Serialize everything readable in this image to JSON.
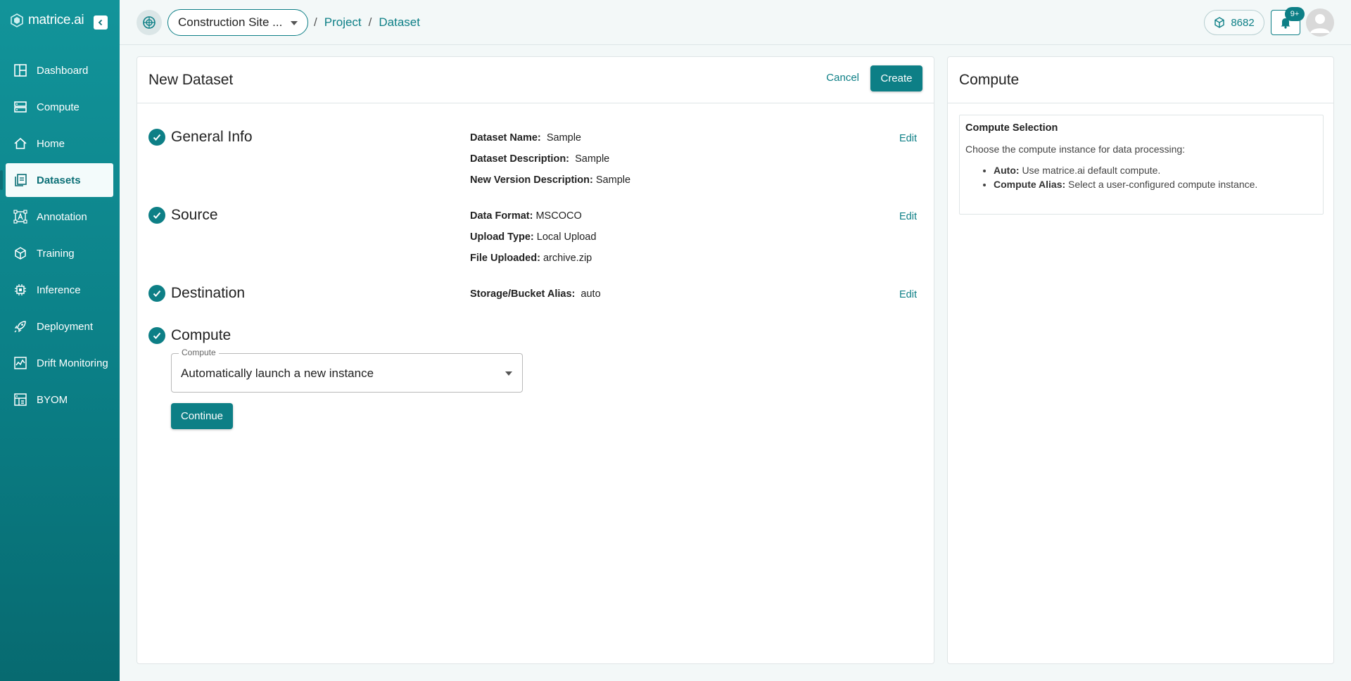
{
  "brand": {
    "name": "matrice.ai"
  },
  "sidebar": {
    "items": [
      {
        "label": "Dashboard",
        "icon": "dashboard-icon",
        "active": false
      },
      {
        "label": "Compute",
        "icon": "server-icon",
        "active": false
      },
      {
        "label": "Home",
        "icon": "home-icon",
        "active": false
      },
      {
        "label": "Datasets",
        "icon": "datasets-icon",
        "active": true
      },
      {
        "label": "Annotation",
        "icon": "annotation-icon",
        "active": false
      },
      {
        "label": "Training",
        "icon": "cube-icon",
        "active": false
      },
      {
        "label": "Inference",
        "icon": "chip-icon",
        "active": false
      },
      {
        "label": "Deployment",
        "icon": "rocket-icon",
        "active": false
      },
      {
        "label": "Drift Monitoring",
        "icon": "chart-icon",
        "active": false
      },
      {
        "label": "BYOM",
        "icon": "model-icon",
        "active": false
      }
    ]
  },
  "header": {
    "project_select": "Construction Site ...",
    "breadcrumbs": [
      "Project",
      "Dataset"
    ],
    "credits": "8682",
    "notification_badge": "9+"
  },
  "main": {
    "title": "New Dataset",
    "cancel_label": "Cancel",
    "create_label": "Create",
    "edit_label": "Edit",
    "steps": {
      "general": {
        "title": "General Info",
        "fields": [
          {
            "label": "Dataset Name:",
            "value": "Sample"
          },
          {
            "label": "Dataset Description:",
            "value": "Sample"
          },
          {
            "label": "New Version Description:",
            "value": "Sample"
          }
        ]
      },
      "source": {
        "title": "Source",
        "fields": [
          {
            "label": "Data Format:",
            "value": "MSCOCO"
          },
          {
            "label": "Upload Type:",
            "value": "Local Upload"
          },
          {
            "label": "File Uploaded:",
            "value": "archive.zip"
          }
        ]
      },
      "destination": {
        "title": "Destination",
        "fields": [
          {
            "label": "Storage/Bucket Alias:",
            "value": "auto"
          }
        ]
      },
      "compute": {
        "title": "Compute",
        "select_label": "Compute",
        "select_value": "Automatically launch a new instance",
        "continue_label": "Continue"
      }
    }
  },
  "side": {
    "title": "Compute",
    "help_title": "Compute Selection",
    "help_desc": "Choose the compute instance for data processing:",
    "help_items": [
      {
        "label": "Auto:",
        "text": "Use matrice.ai default compute."
      },
      {
        "label": "Compute Alias:",
        "text": "Select a user-configured compute instance."
      }
    ]
  },
  "colors": {
    "primary": "#0d7f86",
    "sidebar_top": "#12949a",
    "sidebar_bottom": "#076a70"
  }
}
